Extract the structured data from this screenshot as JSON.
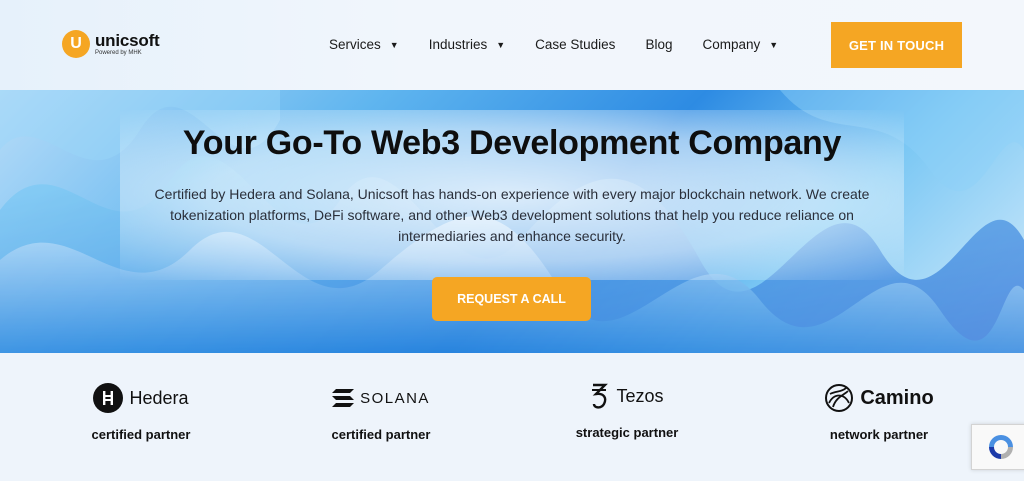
{
  "brand": {
    "name": "unicsoft",
    "tagline": "Powered by MHK",
    "badge_letter": "U"
  },
  "nav": {
    "items": [
      {
        "label": "Services",
        "has_dropdown": true
      },
      {
        "label": "Industries",
        "has_dropdown": true
      },
      {
        "label": "Case Studies",
        "has_dropdown": false
      },
      {
        "label": "Blog",
        "has_dropdown": false
      },
      {
        "label": "Company",
        "has_dropdown": true
      }
    ],
    "cta_label": "GET IN TOUCH"
  },
  "hero": {
    "title": "Your Go-To Web3 Development Company",
    "description": "Certified by Hedera and Solana, Unicsoft has hands-on experience with every major blockchain network. We create tokenization platforms, DeFi software, and other Web3 development solutions that help you reduce reliance on intermediaries and enhance security.",
    "button_label": "REQUEST A CALL"
  },
  "partners": [
    {
      "name": "Hedera",
      "caption": "certified partner",
      "icon": "hedera-icon"
    },
    {
      "name": "SOLANA",
      "caption": "certified partner",
      "icon": "solana-icon"
    },
    {
      "name": "Tezos",
      "caption": "strategic partner",
      "icon": "tezos-icon"
    },
    {
      "name": "Camino",
      "caption": "network partner",
      "icon": "camino-icon"
    }
  ],
  "colors": {
    "accent": "#f5a623",
    "text": "#0e0e0e",
    "hero_blue": "#2d8be3"
  }
}
